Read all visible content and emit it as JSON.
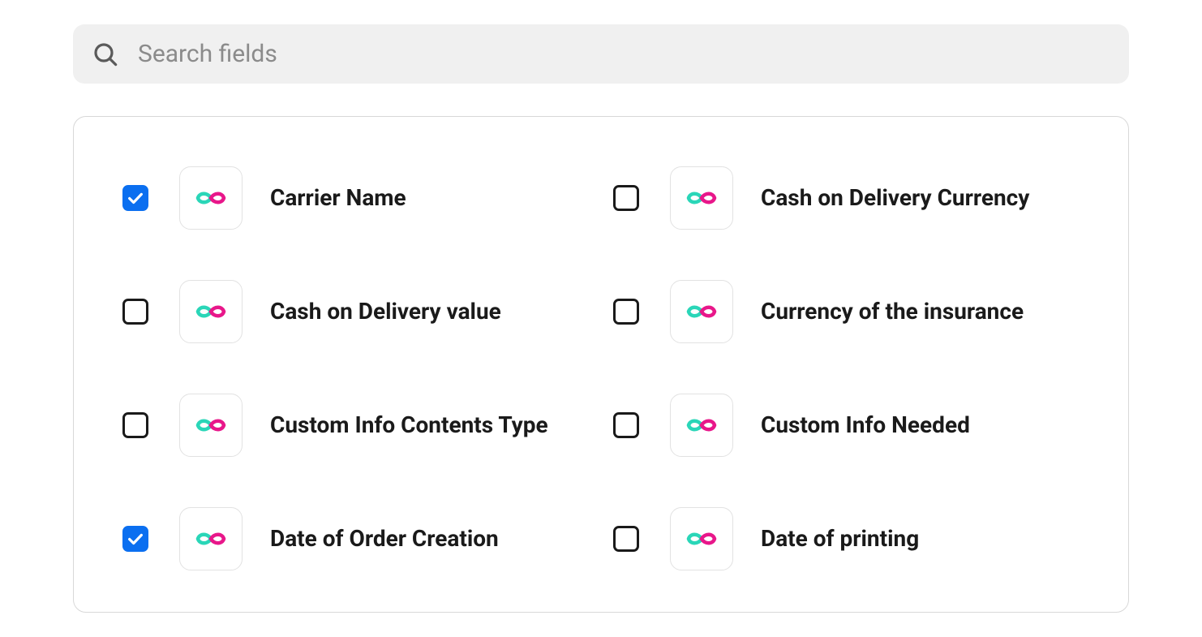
{
  "search": {
    "placeholder": "Search fields"
  },
  "fields": [
    {
      "label": "Carrier Name",
      "checked": true
    },
    {
      "label": "Cash on Delivery Currency",
      "checked": false
    },
    {
      "label": "Cash on Delivery value",
      "checked": false
    },
    {
      "label": "Currency of the insurance",
      "checked": false
    },
    {
      "label": "Custom Info Contents Type",
      "checked": false
    },
    {
      "label": "Custom Info Needed",
      "checked": false
    },
    {
      "label": "Date of Order Creation",
      "checked": true
    },
    {
      "label": "Date of printing",
      "checked": false
    }
  ]
}
